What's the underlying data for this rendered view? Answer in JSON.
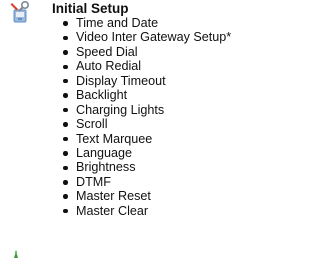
{
  "section": {
    "icon": "settings-tools-icon",
    "title": "Initial Setup",
    "items": [
      {
        "label": "Time and Date"
      },
      {
        "label": "Video Inter Gateway Setup*"
      },
      {
        "label": "Speed Dial"
      },
      {
        "label": "Auto Redial"
      },
      {
        "label": "Display Timeout"
      },
      {
        "label": "Backlight"
      },
      {
        "label": "Charging Lights"
      },
      {
        "label": "Scroll"
      },
      {
        "label": "Text Marquee"
      },
      {
        "label": "Language"
      },
      {
        "label": "Brightness"
      },
      {
        "label": "DTMF"
      },
      {
        "label": "Master Reset"
      },
      {
        "label": "Master Clear"
      }
    ]
  },
  "next_section": {
    "icon": "partial-green-icon"
  },
  "colors": {
    "text": "#111111",
    "icon_blue": "#5b8fc9",
    "icon_red": "#d9432b",
    "icon_green": "#3e9a3a"
  }
}
